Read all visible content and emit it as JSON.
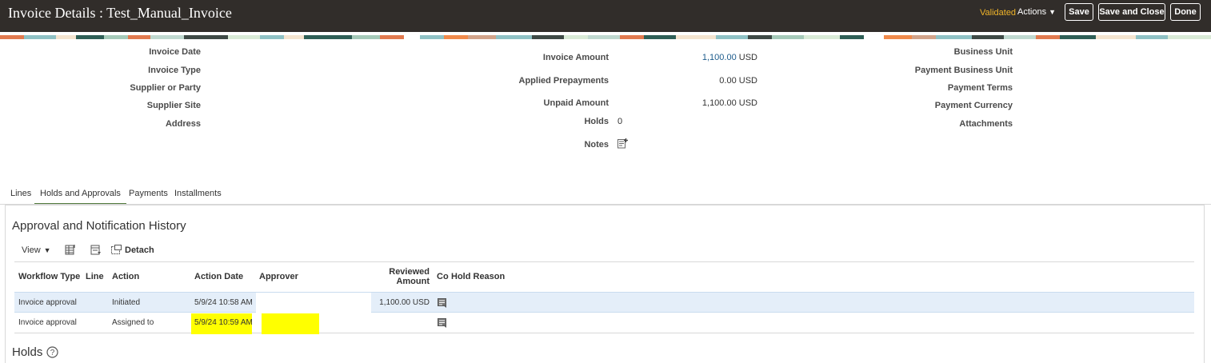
{
  "header": {
    "title": "Invoice Details : Test_Manual_Invoice",
    "status": "Validated",
    "actions_label": "Actions",
    "save_label": "Save",
    "save_close_label": "Save and Close",
    "done_label": "Done",
    "bar_color": "#312d2a",
    "status_color": "#f0b429"
  },
  "summary": {
    "left": {
      "invoice_date_label": "Invoice Date",
      "invoice_type_label": "Invoice Type",
      "supplier_label": "Supplier or Party",
      "supplier_site_label": "Supplier Site",
      "address_label": "Address"
    },
    "middle": {
      "invoice_amount_label": "Invoice Amount",
      "invoice_amount_value": "1,100.00",
      "invoice_amount_currency": "USD",
      "applied_prepayments_label": "Applied Prepayments",
      "applied_prepayments_value": "0.00 USD",
      "unpaid_amount_label": "Unpaid Amount",
      "unpaid_amount_value": "1,100.00 USD",
      "holds_label": "Holds",
      "holds_value": "0",
      "notes_label": "Notes"
    },
    "right": {
      "business_unit_label": "Business Unit",
      "payment_business_unit_label": "Payment Business Unit",
      "payment_terms_label": "Payment Terms",
      "payment_currency_label": "Payment Currency",
      "attachments_label": "Attachments"
    }
  },
  "tabs": [
    {
      "label": "Lines",
      "active": false
    },
    {
      "label": "Holds and Approvals",
      "active": true
    },
    {
      "label": "Payments",
      "active": false
    },
    {
      "label": "Installments",
      "active": false
    }
  ],
  "approval_section": {
    "title": "Approval and Notification History",
    "toolbar": {
      "view_label": "View",
      "detach_label": "Detach"
    },
    "columns": {
      "workflow_type": "Workflow Type",
      "line": "Line",
      "action": "Action",
      "action_date": "Action Date",
      "approver": "Approver",
      "reviewed_amount_1": "Reviewed",
      "reviewed_amount_2": "Amount",
      "comments": "Co",
      "hold_reason": "Hold Reason"
    },
    "rows": [
      {
        "workflow_type": "Invoice approval",
        "line": "",
        "action": "Initiated",
        "action_date": "5/9/24 10:58 AM",
        "approver": "",
        "reviewed_amount": "1,100.00 USD",
        "hold_reason": ""
      },
      {
        "workflow_type": "Invoice approval",
        "line": "",
        "action": "Assigned to",
        "action_date": "5/9/24 10:59 AM",
        "approver": "",
        "reviewed_amount": "",
        "hold_reason": ""
      }
    ],
    "selected_row_color": "#e4eef9",
    "highlight_color": "#ffff00"
  },
  "holds_section": {
    "title": "Holds"
  },
  "accent_colors": {
    "active_tab": "#527a3c",
    "link": "#1d5c8c"
  }
}
